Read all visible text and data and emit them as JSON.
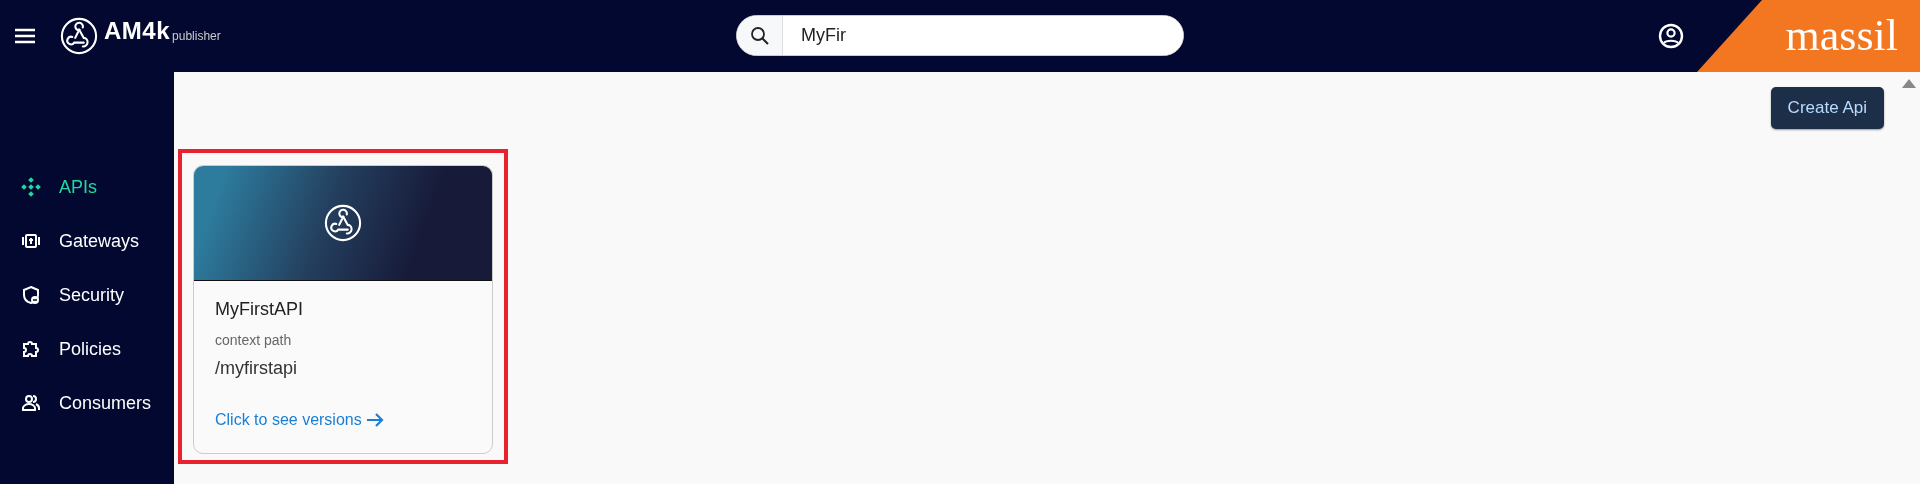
{
  "header": {
    "brand": "AM4k",
    "subtitle": "publisher",
    "search": {
      "value": "MyFir"
    },
    "partner_logo": "massil"
  },
  "sidebar": {
    "items": [
      {
        "label": "APIs",
        "selected": true
      },
      {
        "label": "Gateways",
        "selected": false
      },
      {
        "label": "Security",
        "selected": false
      },
      {
        "label": "Policies",
        "selected": false
      },
      {
        "label": "Consumers",
        "selected": false
      }
    ]
  },
  "toolbar": {
    "button": "Create Api"
  },
  "cards": [
    {
      "name": "MyFirstAPI",
      "context_label": "context path",
      "context_path": "/myfirstapi",
      "link": "Click to see versions",
      "highlighted": true
    }
  ]
}
